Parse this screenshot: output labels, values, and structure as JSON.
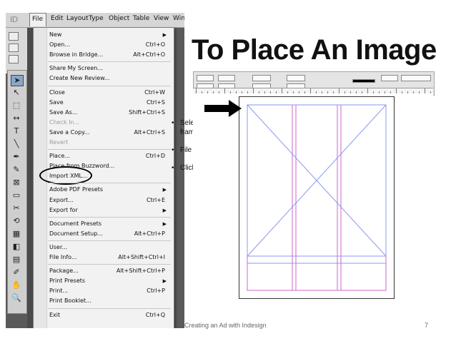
{
  "slide": {
    "title": "To Place An Image",
    "bullets": [
      "Select picture frame",
      "File tab",
      "Click on Place"
    ],
    "footer": "Creating an Ad with Indesign",
    "page_number": "7"
  },
  "app": {
    "logo": "ID",
    "menubar": [
      "File",
      "Edit",
      "Layout",
      "Type",
      "Object",
      "Table",
      "View",
      "Win"
    ]
  },
  "file_menu": [
    {
      "label": "New",
      "shortcut": "",
      "submenu": true,
      "disabled": false
    },
    {
      "label": "Open...",
      "shortcut": "Ctrl+O",
      "submenu": false,
      "disabled": false
    },
    {
      "label": "Browse in Bridge...",
      "shortcut": "Alt+Ctrl+O",
      "submenu": false,
      "disabled": false
    },
    {
      "sep": true
    },
    {
      "label": "Share My Screen...",
      "shortcut": "",
      "submenu": false,
      "disabled": false
    },
    {
      "label": "Create New Review...",
      "shortcut": "",
      "submenu": false,
      "disabled": false
    },
    {
      "sep": true
    },
    {
      "label": "Close",
      "shortcut": "Ctrl+W",
      "submenu": false,
      "disabled": false
    },
    {
      "label": "Save",
      "shortcut": "Ctrl+S",
      "submenu": false,
      "disabled": false
    },
    {
      "label": "Save As...",
      "shortcut": "Shift+Ctrl+S",
      "submenu": false,
      "disabled": false
    },
    {
      "label": "Check In...",
      "shortcut": "",
      "submenu": false,
      "disabled": true
    },
    {
      "label": "Save a Copy...",
      "shortcut": "Alt+Ctrl+S",
      "submenu": false,
      "disabled": false
    },
    {
      "label": "Revert",
      "shortcut": "",
      "submenu": false,
      "disabled": true
    },
    {
      "sep": true
    },
    {
      "label": "Place...",
      "shortcut": "Ctrl+D",
      "submenu": false,
      "disabled": false,
      "highlight": true
    },
    {
      "label": "Place from Buzzword...",
      "shortcut": "",
      "submenu": false,
      "disabled": false
    },
    {
      "label": "Import XML...",
      "shortcut": "",
      "submenu": false,
      "disabled": false
    },
    {
      "sep": true
    },
    {
      "label": "Adobe PDF Presets",
      "shortcut": "",
      "submenu": true,
      "disabled": false
    },
    {
      "label": "Export...",
      "shortcut": "Ctrl+E",
      "submenu": false,
      "disabled": false
    },
    {
      "label": "Export for",
      "shortcut": "",
      "submenu": true,
      "disabled": false
    },
    {
      "sep": true
    },
    {
      "label": "Document Presets",
      "shortcut": "",
      "submenu": true,
      "disabled": false
    },
    {
      "label": "Document Setup...",
      "shortcut": "Alt+Ctrl+P",
      "submenu": false,
      "disabled": false
    },
    {
      "sep": true
    },
    {
      "label": "User...",
      "shortcut": "",
      "submenu": false,
      "disabled": false
    },
    {
      "label": "File Info...",
      "shortcut": "Alt+Shift+Ctrl+I",
      "submenu": false,
      "disabled": false
    },
    {
      "sep": true
    },
    {
      "label": "Package...",
      "shortcut": "Alt+Shift+Ctrl+P",
      "submenu": false,
      "disabled": false
    },
    {
      "label": "Print Presets",
      "shortcut": "",
      "submenu": true,
      "disabled": false
    },
    {
      "label": "Print...",
      "shortcut": "Ctrl+P",
      "submenu": false,
      "disabled": false
    },
    {
      "label": "Print Booklet...",
      "shortcut": "",
      "submenu": false,
      "disabled": false
    },
    {
      "sep": true
    },
    {
      "label": "Exit",
      "shortcut": "Ctrl+Q",
      "submenu": false,
      "disabled": false
    }
  ],
  "tools": [
    "selection-tool-icon",
    "direct-selection-icon",
    "page-tool-icon",
    "gap-tool-icon",
    "type-tool-icon",
    "line-tool-icon",
    "pen-tool-icon",
    "pencil-tool-icon",
    "frame-tool-icon",
    "rectangle-tool-icon",
    "scissors-tool-icon",
    "transform-tool-icon",
    "gradient-tool-icon",
    "gradient-feather-icon",
    "note-tool-icon",
    "eyedropper-tool-icon",
    "hand-tool-icon",
    "zoom-tool-icon"
  ],
  "colors": {
    "guide_magenta": "#cc66cc",
    "guide_blue": "#8899ee",
    "accent_selected": "#8aa7c9"
  }
}
